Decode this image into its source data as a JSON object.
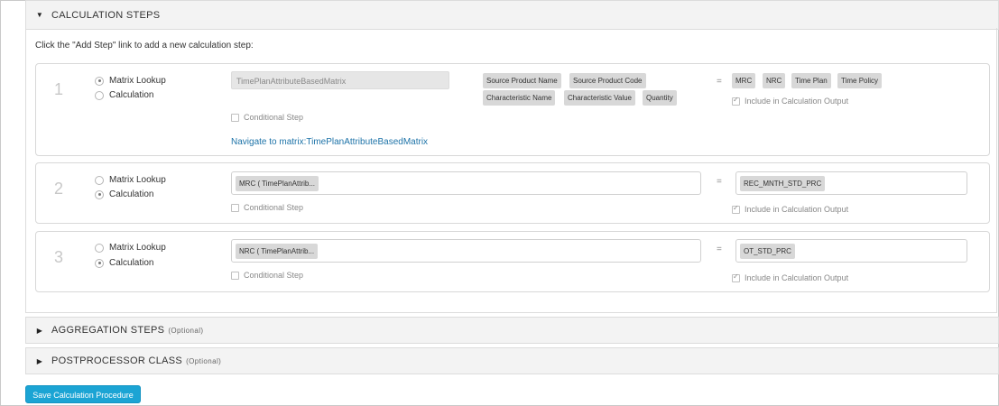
{
  "sections": {
    "calc": {
      "title": "CALCULATION STEPS"
    },
    "agg": {
      "title": "AGGREGATION STEPS",
      "optional": "(Optional)"
    },
    "post": {
      "title": "POSTPROCESSOR CLASS",
      "optional": "(Optional)"
    }
  },
  "intro": "Click the \"Add Step\" link to add a new calculation step:",
  "labels": {
    "matrix_lookup": "Matrix Lookup",
    "calculation": "Calculation",
    "conditional_step": "Conditional Step",
    "include_output": "Include in Calculation Output",
    "equals": "="
  },
  "steps": [
    {
      "number": "1",
      "selected": "matrix_lookup",
      "matrix_name": "TimePlanAttributeBasedMatrix",
      "navigate_link": "Navigate to matrix:TimePlanAttributeBasedMatrix",
      "inputs": [
        "Source Product Name",
        "Source Product Code",
        "Characteristic Name",
        "Characteristic Value",
        "Quantity"
      ],
      "outputs": [
        "MRC",
        "NRC",
        "Time Plan",
        "Time Policy"
      ]
    },
    {
      "number": "2",
      "selected": "calculation",
      "expression": "MRC ( TimePlanAttrib...",
      "output": "REC_MNTH_STD_PRC"
    },
    {
      "number": "3",
      "selected": "calculation",
      "expression": "NRC ( TimePlanAttrib...",
      "output": "OT_STD_PRC"
    }
  ],
  "save_button": "Save Calculation Procedure"
}
